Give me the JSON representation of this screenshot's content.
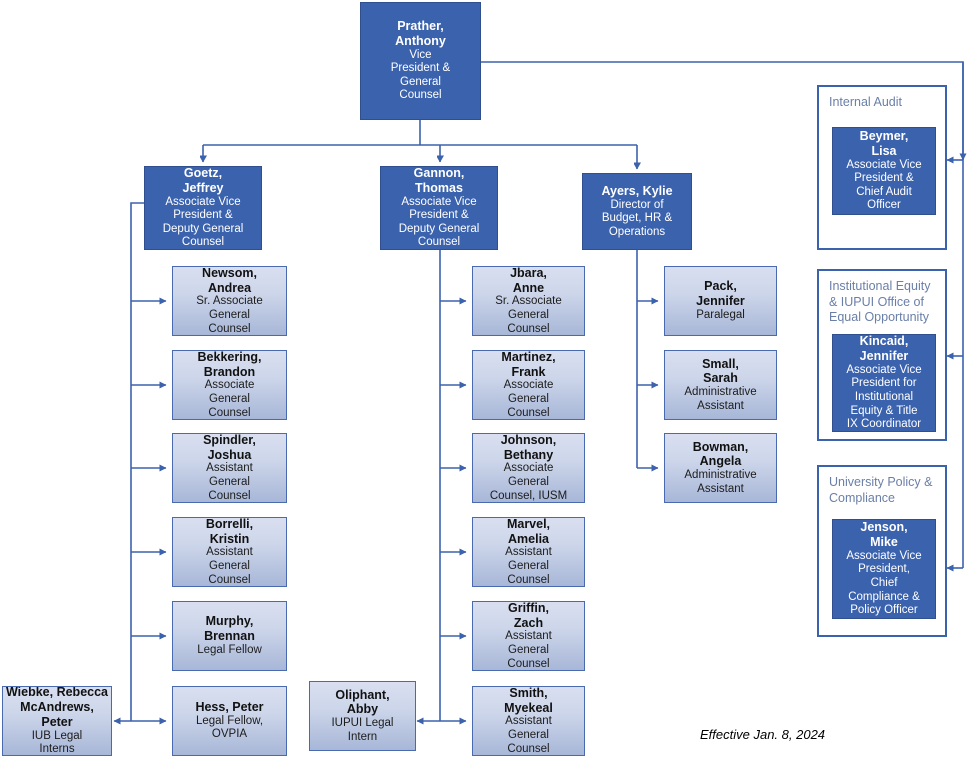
{
  "meta": {
    "effective_note": "Effective Jan. 8, 2024"
  },
  "colors": {
    "executive_fill": "#3b62ad",
    "executive_border": "#2f4f8f",
    "staff_fill_top": "#d9dff0",
    "staff_fill_bottom": "#a8b7d8",
    "staff_border": "#4a6ab0",
    "connector": "#3b62ad",
    "group_border": "#3b62ad",
    "group_title_text": "#6a7fa8"
  },
  "root": {
    "name": "Prather,\nAnthony",
    "title": "Vice\nPresident &\nGeneral\nCounsel"
  },
  "directors": [
    {
      "name": "Goetz,\nJeffrey",
      "title": "Associate Vice\nPresident &\nDeputy General\nCounsel"
    },
    {
      "name": "Gannon,\nThomas",
      "title": "Associate Vice\nPresident &\nDeputy General\nCounsel"
    },
    {
      "name": "Ayers, Kylie",
      "title": "Director of\nBudget, HR &\nOperations"
    }
  ],
  "goetz_reports": [
    {
      "name": "Newsom,\nAndrea",
      "title": "Sr. Associate\nGeneral\nCounsel"
    },
    {
      "name": "Bekkering,\nBrandon",
      "title": "Associate\nGeneral\nCounsel"
    },
    {
      "name": "Spindler,\nJoshua",
      "title": "Assistant\nGeneral\nCounsel"
    },
    {
      "name": "Borrelli,\nKristin",
      "title": "Assistant\nGeneral\nCounsel"
    },
    {
      "name": "Murphy,\nBrennan",
      "title": "Legal Fellow"
    },
    {
      "name": "Hess, Peter",
      "title": "Legal Fellow,\nOVPIA"
    }
  ],
  "gannon_reports": [
    {
      "name": "Jbara,\nAnne",
      "title": "Sr. Associate\nGeneral\nCounsel"
    },
    {
      "name": "Martinez,\nFrank",
      "title": "Associate\nGeneral\nCounsel"
    },
    {
      "name": "Johnson,\nBethany",
      "title": "Associate\nGeneral\nCounsel, IUSM"
    },
    {
      "name": "Marvel,\nAmelia",
      "title": "Assistant\nGeneral\nCounsel"
    },
    {
      "name": "Griffin,\nZach",
      "title": "Assistant\nGeneral\nCounsel"
    },
    {
      "name": "Smith,\nMyekeal",
      "title": "Assistant\nGeneral\nCounsel"
    }
  ],
  "ayers_reports": [
    {
      "name": "Pack,\nJennifer",
      "title": "Paralegal"
    },
    {
      "name": "Small,\nSarah",
      "title": "Administrative\nAssistant"
    },
    {
      "name": "Bowman,\nAngela",
      "title": "Administrative\nAssistant"
    }
  ],
  "interns": [
    {
      "name": "Wiebke, Rebecca\nMcAndrews, Peter",
      "title": "IUB Legal\nInterns"
    },
    {
      "name": "Oliphant,\nAbby",
      "title": "IUPUI Legal\nIntern"
    }
  ],
  "groups": [
    {
      "title": "Internal Audit",
      "person": {
        "name": "Beymer,\nLisa",
        "title": "Associate Vice\nPresident &\nChief Audit\nOfficer"
      }
    },
    {
      "title": "Institutional Equity\n& IUPUI Office of\nEqual Opportunity",
      "person": {
        "name": "Kincaid,\nJennifer",
        "title": "Associate Vice\nPresident for\nInstitutional\nEquity & Title\nIX Coordinator"
      }
    },
    {
      "title": "University Policy &\nCompliance",
      "person": {
        "name": "Jenson,\nMike",
        "title": "Associate Vice\nPresident,\nChief\nCompliance &\nPolicy Officer"
      }
    }
  ]
}
